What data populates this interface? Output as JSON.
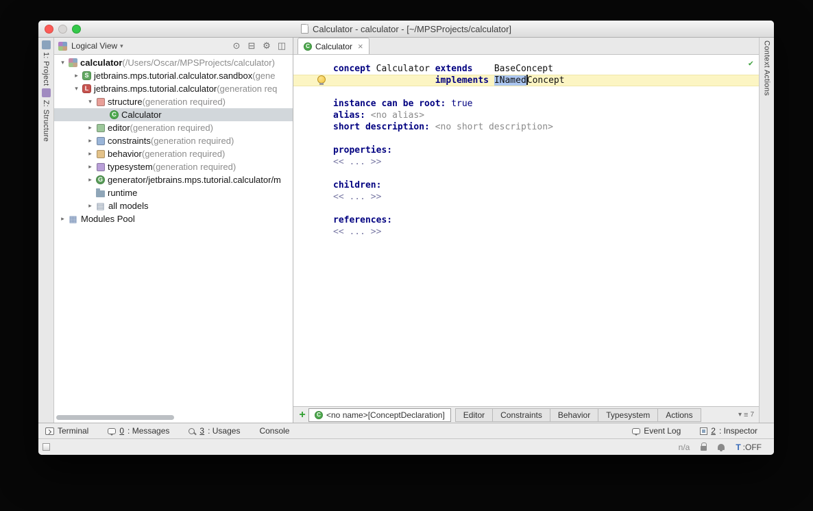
{
  "window": {
    "title": "Calculator - calculator - [~/MPSProjects/calculator]"
  },
  "header": {
    "view_label": "Logical View",
    "dropdown_glyph": "▾",
    "tools": [
      {
        "id": "locate",
        "glyph": "⊙"
      },
      {
        "id": "collapse-all",
        "glyph": "⊟"
      },
      {
        "id": "settings",
        "glyph": "⚙"
      },
      {
        "id": "hide-panel",
        "glyph": "◫"
      }
    ]
  },
  "left_strip": {
    "buttons": [
      {
        "id": "project",
        "label": "1: Project"
      },
      {
        "id": "structure",
        "label": "Z: Structure"
      }
    ]
  },
  "right_strip": {
    "buttons": [
      {
        "id": "context-actions",
        "label": "Context Actions"
      }
    ]
  },
  "tree": {
    "rows": [
      {
        "level": 0,
        "arrow": "expanded",
        "icon": "project",
        "badge": "",
        "label": "calculator",
        "suffix": " (/Users/Oscar/MPSProjects/calculator)",
        "bold": true,
        "warn": true
      },
      {
        "level": 1,
        "arrow": "collapsed",
        "icon": "solution",
        "badge": "S",
        "label": "jetbrains.mps.tutorial.calculator.sandbox",
        "suffix": " (gene",
        "warn": true
      },
      {
        "level": 1,
        "arrow": "expanded",
        "icon": "language",
        "badge": "L",
        "label": "jetbrains.mps.tutorial.calculator",
        "suffix": " (generation req",
        "warn": true
      },
      {
        "level": 2,
        "arrow": "expanded",
        "icon": "aspect-structure",
        "badge": "",
        "label": "structure",
        "suffix": " (generation required)"
      },
      {
        "level": 3,
        "arrow": "none",
        "icon": "concept",
        "badge": "C",
        "label": "Calculator",
        "suffix": "",
        "selected": true
      },
      {
        "level": 2,
        "arrow": "collapsed",
        "icon": "aspect-editor",
        "badge": "",
        "label": "editor",
        "suffix": " (generation required)"
      },
      {
        "level": 2,
        "arrow": "collapsed",
        "icon": "aspect-constraints",
        "badge": "",
        "label": "constraints",
        "suffix": " (generation required)"
      },
      {
        "level": 2,
        "arrow": "collapsed",
        "icon": "aspect-behavior",
        "badge": "",
        "label": "behavior",
        "suffix": " (generation required)"
      },
      {
        "level": 2,
        "arrow": "collapsed",
        "icon": "aspect-typesystem",
        "badge": "",
        "label": "typesystem",
        "suffix": " (generation required)"
      },
      {
        "level": 2,
        "arrow": "collapsed",
        "icon": "generator",
        "badge": "G",
        "label": "generator/jetbrains.mps.tutorial.calculator/m",
        "suffix": ""
      },
      {
        "level": 2,
        "arrow": "none",
        "icon": "folder",
        "badge": "",
        "label": "runtime",
        "suffix": ""
      },
      {
        "level": 2,
        "arrow": "collapsed",
        "icon": "models",
        "badge": "",
        "label": "all models",
        "suffix": ""
      },
      {
        "level": 0,
        "arrow": "collapsed",
        "icon": "modules",
        "badge": "",
        "label": "Modules Pool",
        "suffix": ""
      }
    ]
  },
  "editor": {
    "tab": {
      "icon_badge": "C",
      "label": "Calculator",
      "close": "×"
    },
    "status_check": "✔",
    "lines": [
      {
        "hl": false,
        "bulb": false,
        "segs": [
          [
            "kw",
            "concept "
          ],
          [
            "txt",
            "Calculator "
          ],
          [
            "kw",
            "extends"
          ],
          [
            "txt",
            "    "
          ],
          [
            "txt",
            "BaseConcept"
          ]
        ]
      },
      {
        "hl": true,
        "bulb": true,
        "segs": [
          [
            "txt",
            "                   "
          ],
          [
            "kw",
            "implements "
          ],
          [
            "sel",
            "INamed"
          ],
          [
            "caret",
            ""
          ],
          [
            "txt",
            "Concept"
          ]
        ]
      },
      {
        "segs": []
      },
      {
        "segs": [
          [
            "kw",
            "instance can be root: "
          ],
          [
            "bool",
            "true"
          ]
        ]
      },
      {
        "segs": [
          [
            "kw",
            "alias: "
          ],
          [
            "ph",
            "<no alias>"
          ]
        ]
      },
      {
        "segs": [
          [
            "kw",
            "short description: "
          ],
          [
            "ph",
            "<no short description>"
          ]
        ]
      },
      {
        "segs": []
      },
      {
        "segs": [
          [
            "kw",
            "properties:"
          ]
        ]
      },
      {
        "segs": [
          [
            "cell",
            "<< ... >>"
          ]
        ]
      },
      {
        "segs": []
      },
      {
        "segs": [
          [
            "kw",
            "children:"
          ]
        ]
      },
      {
        "segs": [
          [
            "cell",
            "<< ... >>"
          ]
        ]
      },
      {
        "segs": []
      },
      {
        "segs": [
          [
            "kw",
            "references:"
          ]
        ]
      },
      {
        "segs": [
          [
            "cell",
            "<< ... >>"
          ]
        ]
      }
    ],
    "bottom": {
      "add": "+",
      "node_label": "<no name>[ConceptDeclaration]",
      "tabs": [
        "Editor",
        "Constraints",
        "Behavior",
        "Typesystem",
        "Actions"
      ],
      "menu_caret": "▾",
      "menu_list": "≡",
      "tab_count": "7"
    }
  },
  "toolbar": {
    "left": [
      {
        "id": "terminal",
        "icon": "terminal",
        "mnemonic": "",
        "label": "Terminal"
      },
      {
        "id": "messages",
        "icon": "balloon",
        "mnemonic": "0",
        "label": ": Messages"
      },
      {
        "id": "usages",
        "icon": "magnifier",
        "mnemonic": "3",
        "label": ": Usages"
      },
      {
        "id": "console",
        "icon": "",
        "mnemonic": "",
        "label": "Console"
      }
    ],
    "right": [
      {
        "id": "event-log",
        "icon": "balloon",
        "mnemonic": "",
        "label": "Event Log"
      },
      {
        "id": "inspector",
        "icon": "inspector",
        "mnemonic": "2",
        "label": ": Inspector"
      }
    ]
  },
  "statusbar": {
    "position": "n/a",
    "toggle_letter": "T",
    "toggle_state": ":OFF"
  }
}
